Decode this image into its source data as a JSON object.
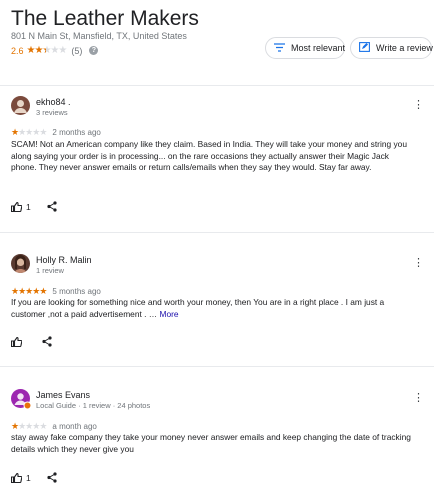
{
  "business": {
    "name": "The Leather Makers",
    "address": "801 N Main St, Mansfield, TX, United States",
    "rating": "2.6",
    "stars": 2.6,
    "review_count": "(5)"
  },
  "toolbar": {
    "sort_label": "Most relevant",
    "write_label": "Write a review"
  },
  "reviews": [
    {
      "author": "ekho84 .",
      "meta": "3 reviews",
      "stars": 1,
      "when": "2 months ago",
      "text": "SCAM! Not an American company like they claim. Based in India. They will take your money and string you along saying your order is in processing... on the rare occasions they actually answer their Magic Jack phone. They never answer emails or return calls/emails when they say they would. Stay far away.",
      "likes": "1"
    },
    {
      "author": "Holly R. Malin",
      "meta": "1 review",
      "stars": 5,
      "when": "5 months ago",
      "text": "If you are looking for something nice and worth your money, then You are in a right place . I am just a customer ,not a paid advertisement . …",
      "more": "More",
      "likes": ""
    },
    {
      "author": "James Evans",
      "meta": "Local Guide · 1 review · 24 photos",
      "stars": 1,
      "when": "a month ago",
      "text": "stay away fake company they take your money never answer emails and keep changing the date of tracking details which they never give you",
      "likes": "1"
    }
  ],
  "colors": {
    "star": "#e37400",
    "star_empty": "#dadce0",
    "link": "#1a0dab",
    "accent": "#1a73e8"
  }
}
